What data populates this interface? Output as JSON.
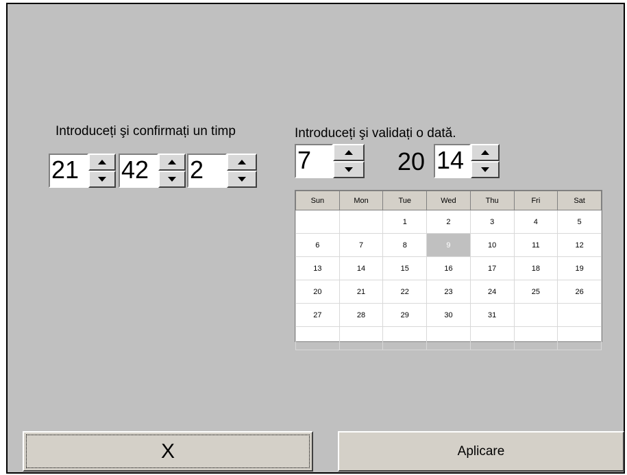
{
  "time": {
    "title": "Introduceți şi confirmați un timp",
    "hours": "21",
    "minutes": "42",
    "seconds": "2"
  },
  "date": {
    "title": "Introduceți şi validați o dată.",
    "month": "7",
    "year_prefix": "20",
    "year_suffix": "14"
  },
  "calendar": {
    "weekdays": [
      "Sun",
      "Mon",
      "Tue",
      "Wed",
      "Thu",
      "Fri",
      "Sat"
    ],
    "weeks": [
      [
        "",
        "",
        "1",
        "2",
        "3",
        "4",
        "5"
      ],
      [
        "6",
        "7",
        "8",
        "9",
        "10",
        "11",
        "12"
      ],
      [
        "13",
        "14",
        "15",
        "16",
        "17",
        "18",
        "19"
      ],
      [
        "20",
        "21",
        "22",
        "23",
        "24",
        "25",
        "26"
      ],
      [
        "27",
        "28",
        "29",
        "30",
        "31",
        "",
        ""
      ],
      [
        "",
        "",
        "",
        "",
        "",
        "",
        ""
      ]
    ],
    "selected_day": "9"
  },
  "buttons": {
    "cancel_label": "X",
    "apply_label": "Aplicare"
  }
}
